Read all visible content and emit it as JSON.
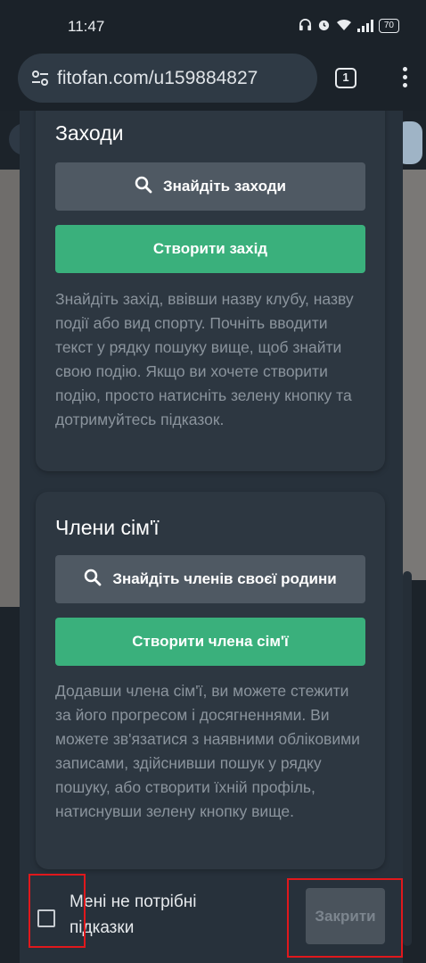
{
  "status_bar": {
    "time": "11:47",
    "battery": "70",
    "icons": [
      "headphones-icon",
      "alarm-icon",
      "wifi-icon",
      "signal-icon",
      "battery-icon"
    ]
  },
  "browser": {
    "url": "fitofan.com/u159884827",
    "tab_count": "1"
  },
  "events_card": {
    "title": "Заходи",
    "search_button": "Знайдіть заходи",
    "create_button": "Створити захід",
    "description": "Знайдіть захід, ввівши назву клубу, назву події або вид спорту. Почніть вводити текст у рядку пошуку вище, щоб знайти свою подію. Якщо ви хочете створити подію, просто натисніть зелену кнопку та дотримуйтесь підказок."
  },
  "family_card": {
    "title": "Члени сім'ї",
    "search_button": "Знайдіть членів своєї родини",
    "create_button": "Створити члена сім'ї",
    "description": "Додавши члена сім'ї, ви можете стежити за його прогресом і досягненнями. Ви можете зв'язатися з наявними обліковими записами, здійснивши пошук у рядку пошуку, або створити їхній профіль, натиснувши зелену кнопку вище."
  },
  "footer": {
    "checkbox_label": "Мені не потрібні підказки",
    "checkbox_checked": false,
    "close_button": "Закрити"
  },
  "colors": {
    "primary_green": "#3ab07c",
    "secondary_grey": "#4f5963",
    "highlight_red": "#e0181c"
  }
}
